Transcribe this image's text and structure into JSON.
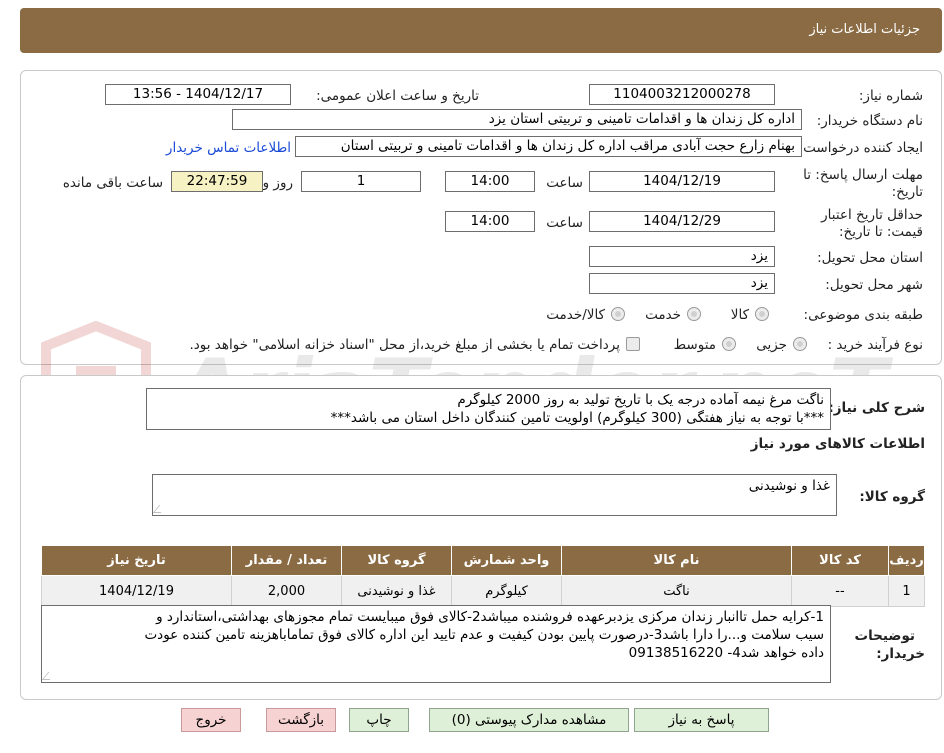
{
  "header": {
    "title": "جزئیات اطلاعات نیاز"
  },
  "form": {
    "need_number_label": "شماره نیاز:",
    "need_number": "1104003212000278",
    "announce_label": "تاریخ و ساعت اعلان عمومی:",
    "announce_value": "1404/12/17 - 13:56",
    "buyer_org_label": "نام دستگاه خریدار:",
    "buyer_org": "اداره کل زندان ها و اقدامات تامینی و تربیتی استان یزد",
    "creator_label": "ایجاد کننده درخواست:",
    "creator": "بهنام زارع حجت آبادی مراقب اداره کل زندان ها و اقدامات تامینی و تربیتی استان",
    "contact_link": "اطلاعات تماس خریدار",
    "deadline_label_1": "مهلت ارسال پاسخ: تا",
    "deadline_label_2": "تاریخ:",
    "deadline_date": "1404/12/19",
    "time_label": "ساعت",
    "deadline_time": "14:00",
    "days_value": "1",
    "days_label": "روز و",
    "remaining_time": "22:47:59",
    "remaining_label": "ساعت باقی مانده",
    "validity_label_1": "حداقل تاریخ اعتبار",
    "validity_label_2": "قیمت: تا تاریخ:",
    "validity_date": "1404/12/29",
    "validity_time": "14:00",
    "province_label": "استان محل تحویل:",
    "province": "یزد",
    "city_label": "شهر محل تحویل:",
    "city": "یزد",
    "category_label": "طبقه بندی موضوعی:",
    "category_options": [
      "کالا",
      "خدمت",
      "کالا/خدمت"
    ],
    "process_label": "نوع فرآیند خرید :",
    "process_options": [
      "جزیی",
      "متوسط"
    ],
    "payment_note": "پرداخت تمام یا بخشی از مبلغ خرید،از محل \"اسناد خزانه اسلامی\" خواهد بود."
  },
  "summary": {
    "label": "شرح کلی نیاز:",
    "line1": "ناگت مرغ نیمه آماده درجه یک با تاریخ تولید به روز 2000 کیلوگرم",
    "line2": "***با توجه به نیاز هفتگی (300 کیلوگرم) اولویت تامین کنندگان داخل استان می باشد***"
  },
  "goods": {
    "section_title": "اطلاعات کالاهای مورد نیاز",
    "group_label": "گروه کالا:",
    "group_value": "غذا و نوشیدنی",
    "table_headers": [
      "ردیف",
      "کد کالا",
      "نام کالا",
      "واحد شمارش",
      "گروه کالا",
      "تعداد / مقدار",
      "تاریخ نیاز"
    ],
    "rows": [
      [
        "1",
        "--",
        "ناگت",
        "کیلوگرم",
        "غذا و نوشیدنی",
        "2,000",
        "1404/12/19"
      ]
    ]
  },
  "buyer_notes": {
    "label_1": "توضیحات",
    "label_2": "خریدار:",
    "line1": "1-کرایه حمل تاانبار زندان مرکزی یزدبرعهده فروشنده میباشد2-کالای فوق میبایست تمام مجوزهای بهداشتی،استاندارد و",
    "line2": "سیب سلامت و...را دارا باشد3-درصورت پایین بودن کیفیت و عدم تایید این اداره کالای فوق تماماباهزینه تامین کننده عودت",
    "line3": "داده خواهد شد4- 09138516220"
  },
  "buttons": {
    "reply": "پاسخ به نیاز",
    "attachments": "مشاهده مدارک پیوستی (0)",
    "print": "چاپ",
    "back": "بازگشت",
    "exit": "خروج"
  },
  "watermark": {
    "text": "AriaTender.neT"
  },
  "colors": {
    "header_bg": "#8a6b43",
    "timer_bg": "#f6f2c4",
    "link": "#1a4bd6",
    "button_green": "#dff0d8",
    "button_red": "#f7d2d2"
  }
}
